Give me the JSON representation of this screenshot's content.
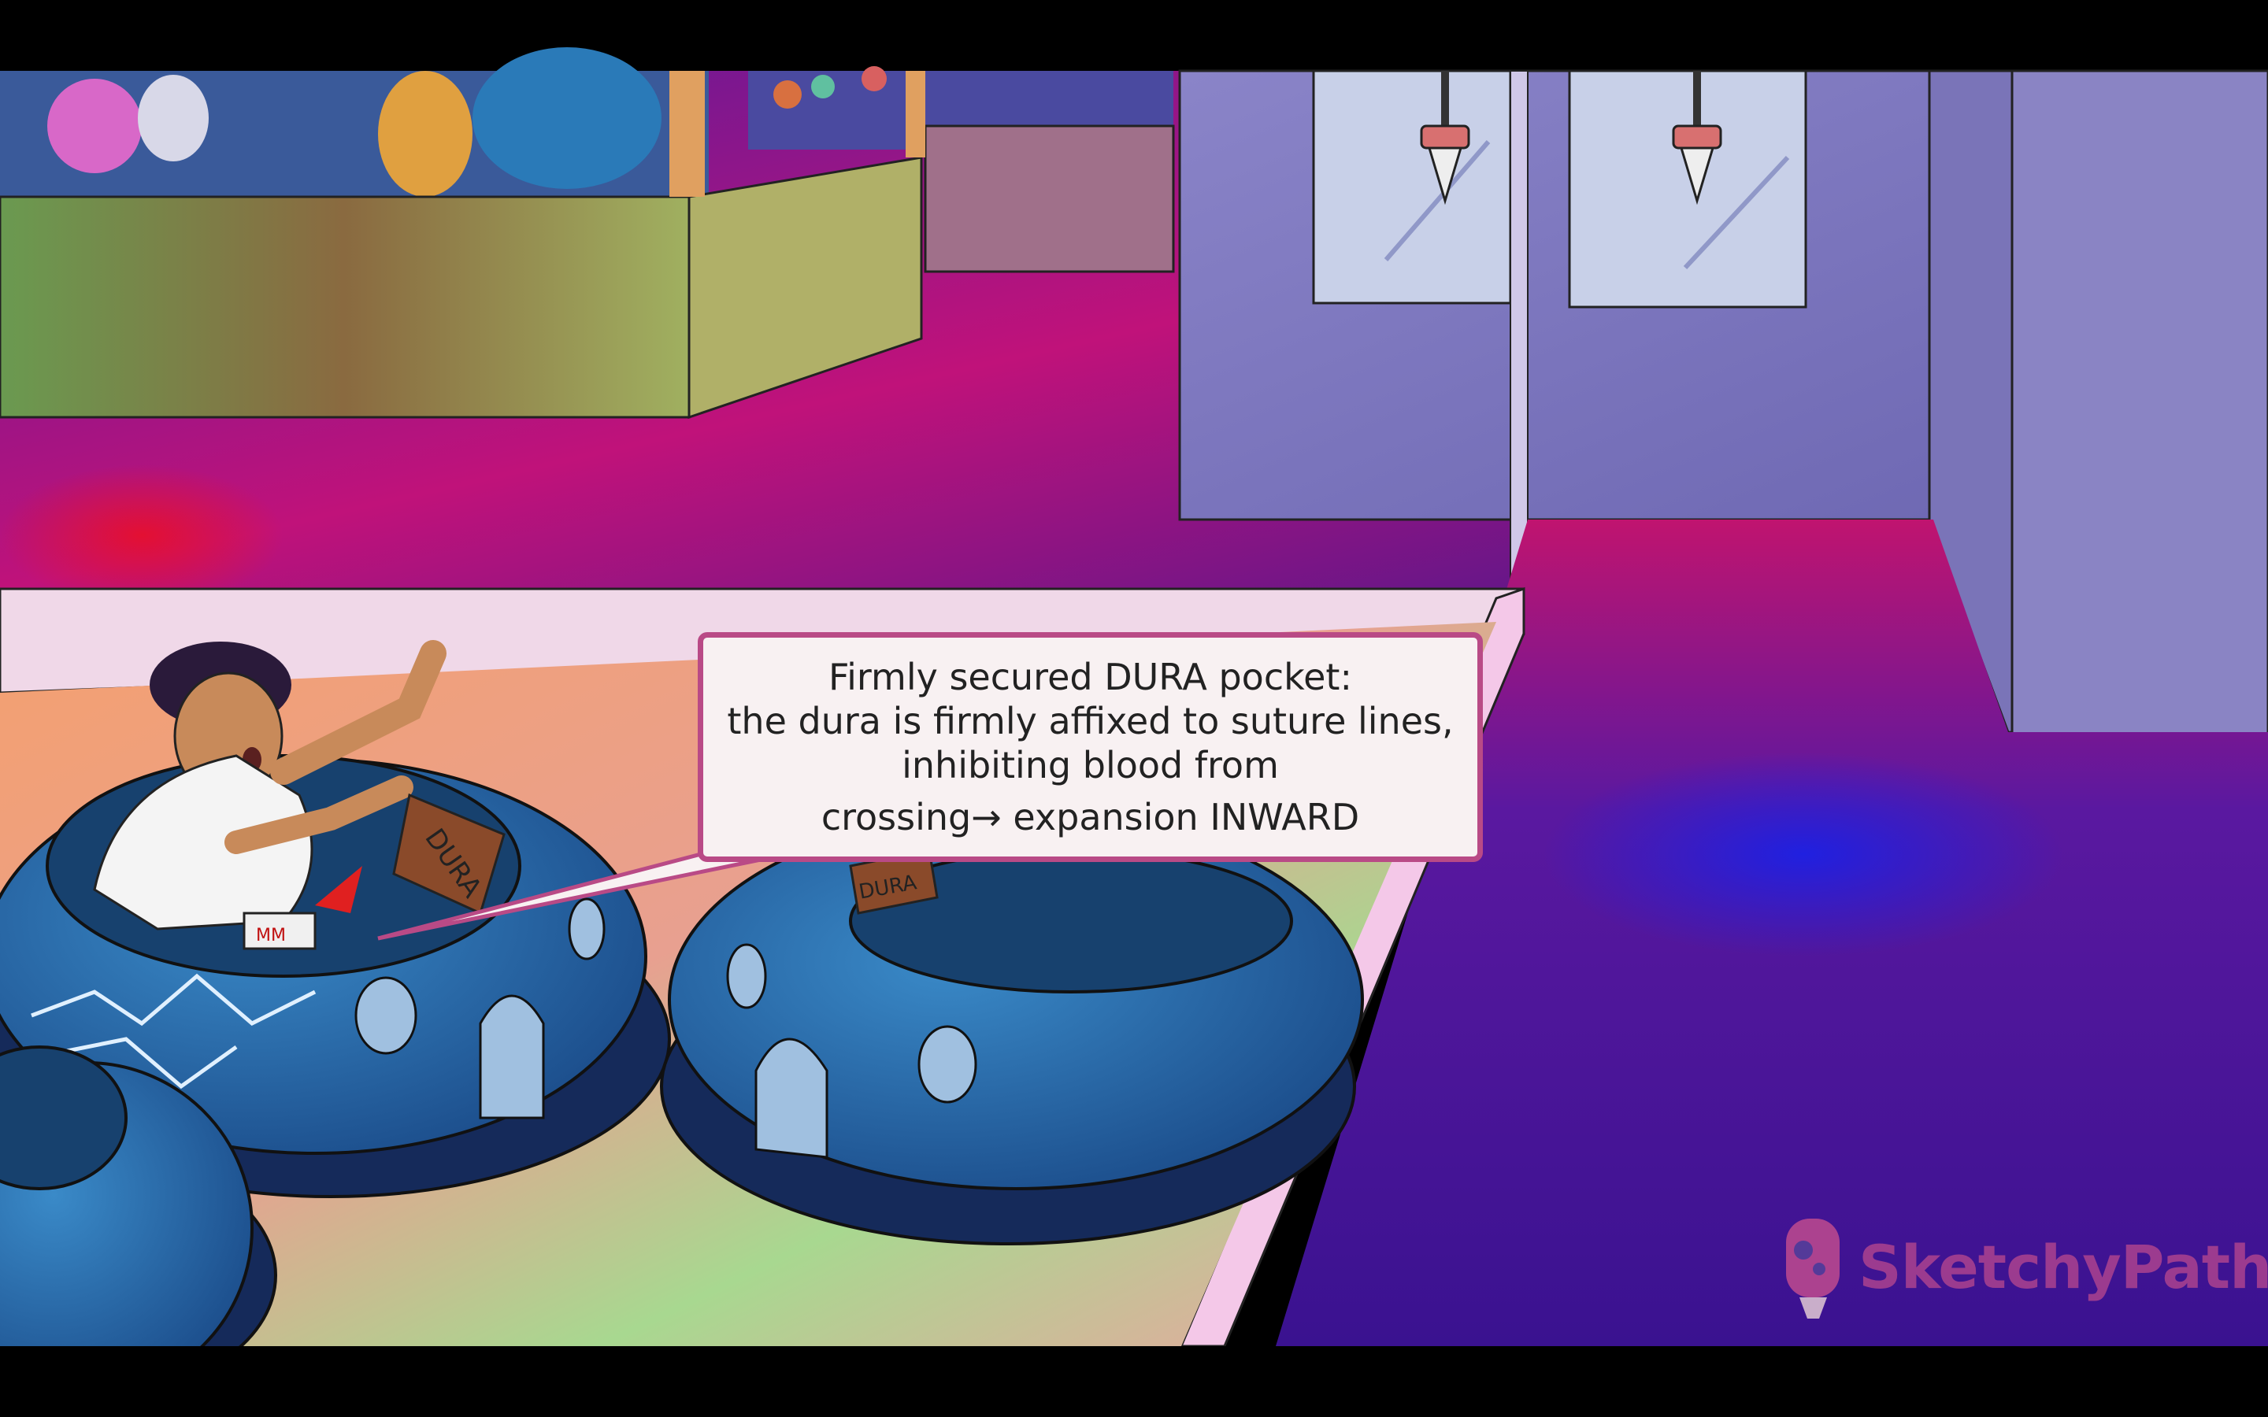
{
  "caption": {
    "line1": "Firmly secured DURA pocket:",
    "line2": "the dura is firmly affixed to suture lines,",
    "line3": "inhibiting blood from",
    "line4": "crossing→ expansion INWARD"
  },
  "scene_labels": {
    "car1_sign": "DURA",
    "car2_sign": "DURA",
    "cup_label": "MM"
  },
  "logo": {
    "text": "SketchyPath",
    "icon": "sketchy-bulb-icon"
  },
  "colors": {
    "letterbox": "#000000",
    "caption_border": "#b94a86",
    "caption_bg": "#f8f1f2",
    "bumper_car": "#2a6aa8",
    "floor_magenta": "#c8127a",
    "floor_blue": "#2a1ad0",
    "wall_lavender": "#7f79c0"
  }
}
